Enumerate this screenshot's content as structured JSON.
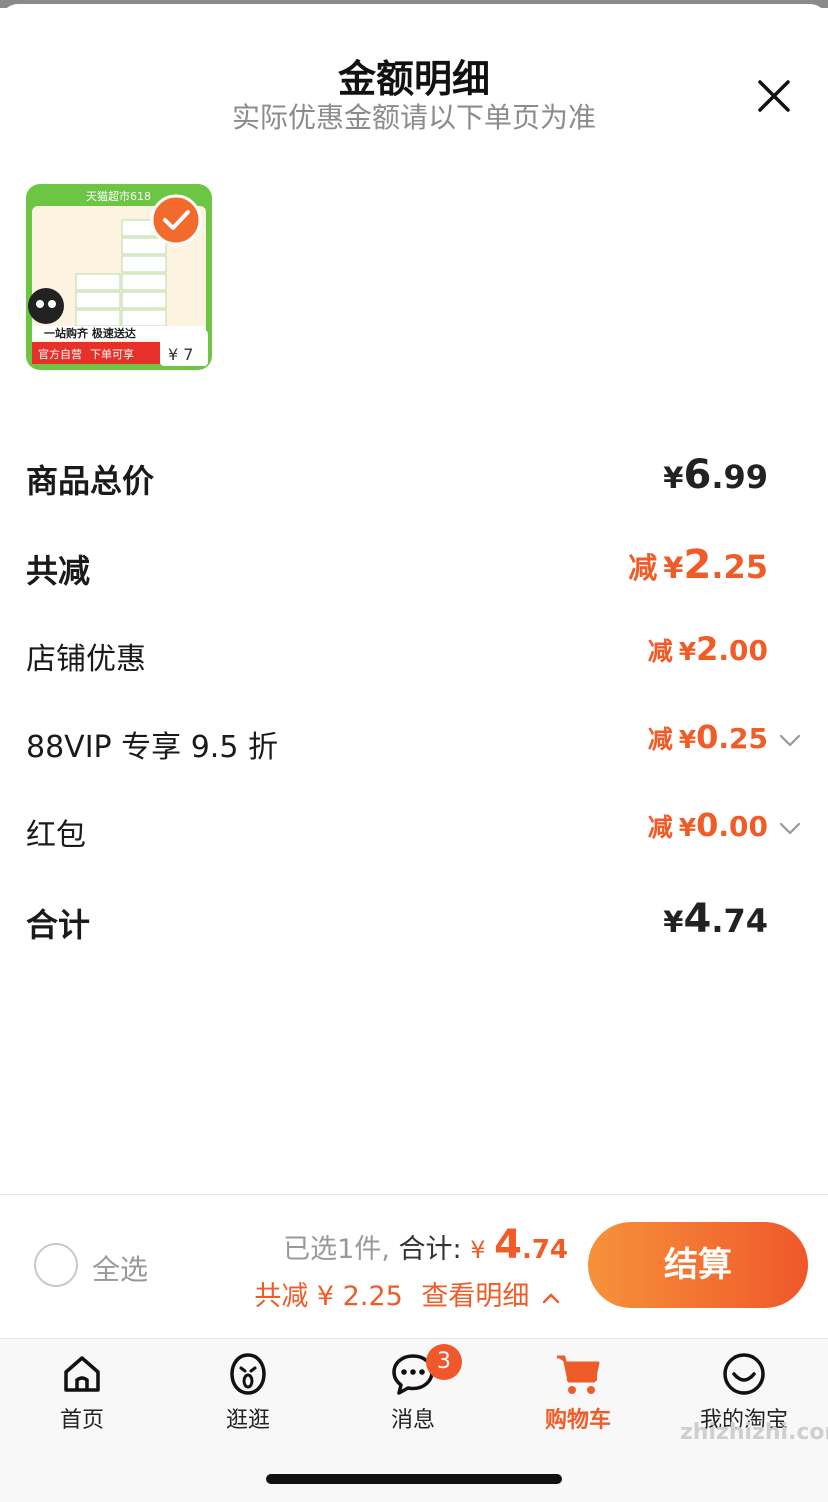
{
  "header": {
    "title": "金额明细",
    "subtitle": "实际优惠金额请以下单页为准"
  },
  "product": {
    "banner": "天猫超市618",
    "promo_line": "一站购齐 极速送达",
    "tag1": "官方自营",
    "tag2": "下单可享",
    "price_hint": "¥ 7"
  },
  "rows": [
    {
      "label": "商品总价",
      "prefix": "",
      "yen": "¥",
      "int": "6",
      "dec": ".99",
      "color": "dark",
      "chevron": false
    },
    {
      "label": "共减",
      "prefix": "减",
      "yen": "¥",
      "int": "2",
      "dec": ".25",
      "color": "orange",
      "chevron": false
    },
    {
      "label": "店铺优惠",
      "prefix": "减",
      "yen": "¥",
      "int": "2",
      "dec": ".00",
      "color": "orange",
      "chevron": false
    },
    {
      "label": "88VIP 专享 9.5 折",
      "prefix": "减",
      "yen": "¥",
      "int": "0",
      "dec": ".25",
      "color": "orange",
      "chevron": true
    },
    {
      "label": "红包",
      "prefix": "减",
      "yen": "¥",
      "int": "0",
      "dec": ".00",
      "color": "orange",
      "chevron": true
    },
    {
      "label": "合计",
      "prefix": "",
      "yen": "¥",
      "int": "4",
      "dec": ".74",
      "color": "dark",
      "chevron": false
    }
  ],
  "bottom": {
    "select_all": "全选",
    "selected_text": "已选1件,",
    "total_label": "合计:",
    "total_yen": "¥",
    "total_int": "4",
    "total_dec": ".74",
    "discount_text": "共减 ¥ 2.25",
    "details_link": "查看明细",
    "checkout": "结算"
  },
  "tabs": [
    {
      "label": "首页",
      "icon": "home-icon"
    },
    {
      "label": "逛逛",
      "icon": "browse-face-icon"
    },
    {
      "label": "消息",
      "icon": "message-icon",
      "badge": "3"
    },
    {
      "label": "购物车",
      "icon": "cart-icon",
      "active": true
    },
    {
      "label": "我的淘宝",
      "icon": "smile-face-icon"
    }
  ],
  "watermark": "zhizhizhi.com",
  "colors": {
    "accent": "#f05c28",
    "checkout_gradient_start": "#f6923a",
    "checkout_gradient_end": "#f0572a"
  }
}
